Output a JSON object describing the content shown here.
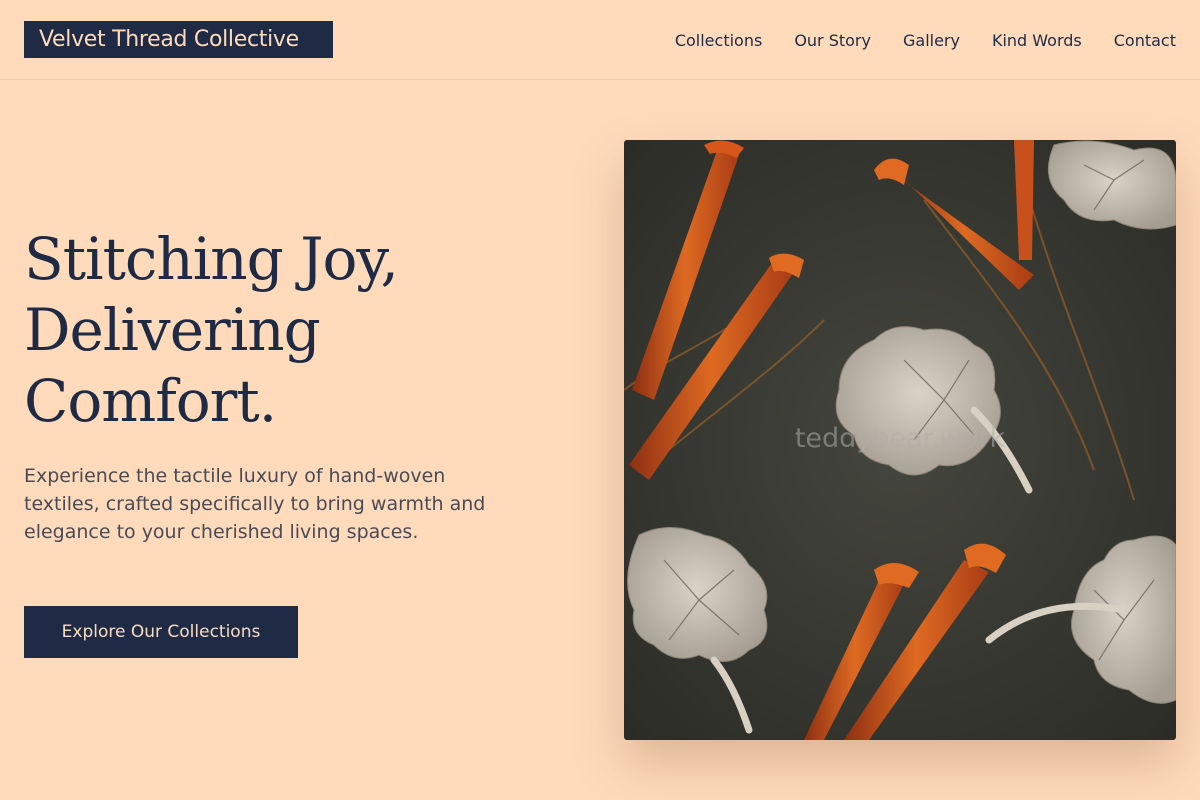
{
  "brand": {
    "name": "Velvet Thread Collective"
  },
  "nav": {
    "items": [
      "Collections",
      "Our Story",
      "Gallery",
      "Kind Words",
      "Contact"
    ]
  },
  "hero": {
    "title_lines": [
      "Stitching Joy,",
      "Delivering",
      "Comfort."
    ],
    "description": "Experience the tactile luxury of hand-woven textiles, crafted specifically to bring warmth and elegance to your cherished living spaces.",
    "cta_label": "Explore Our Collections",
    "image": {
      "subject": "dark textile with orange flower stems and pale leaves",
      "watermark": "teddybear.work"
    }
  },
  "colors": {
    "background": "#ffdbbb",
    "navy": "#1f2a44",
    "fabric": "#3c3d36",
    "orange": "#c7501c",
    "leaf": "#c9c0b4"
  },
  "icons": [
    "floral-fabric-image"
  ]
}
